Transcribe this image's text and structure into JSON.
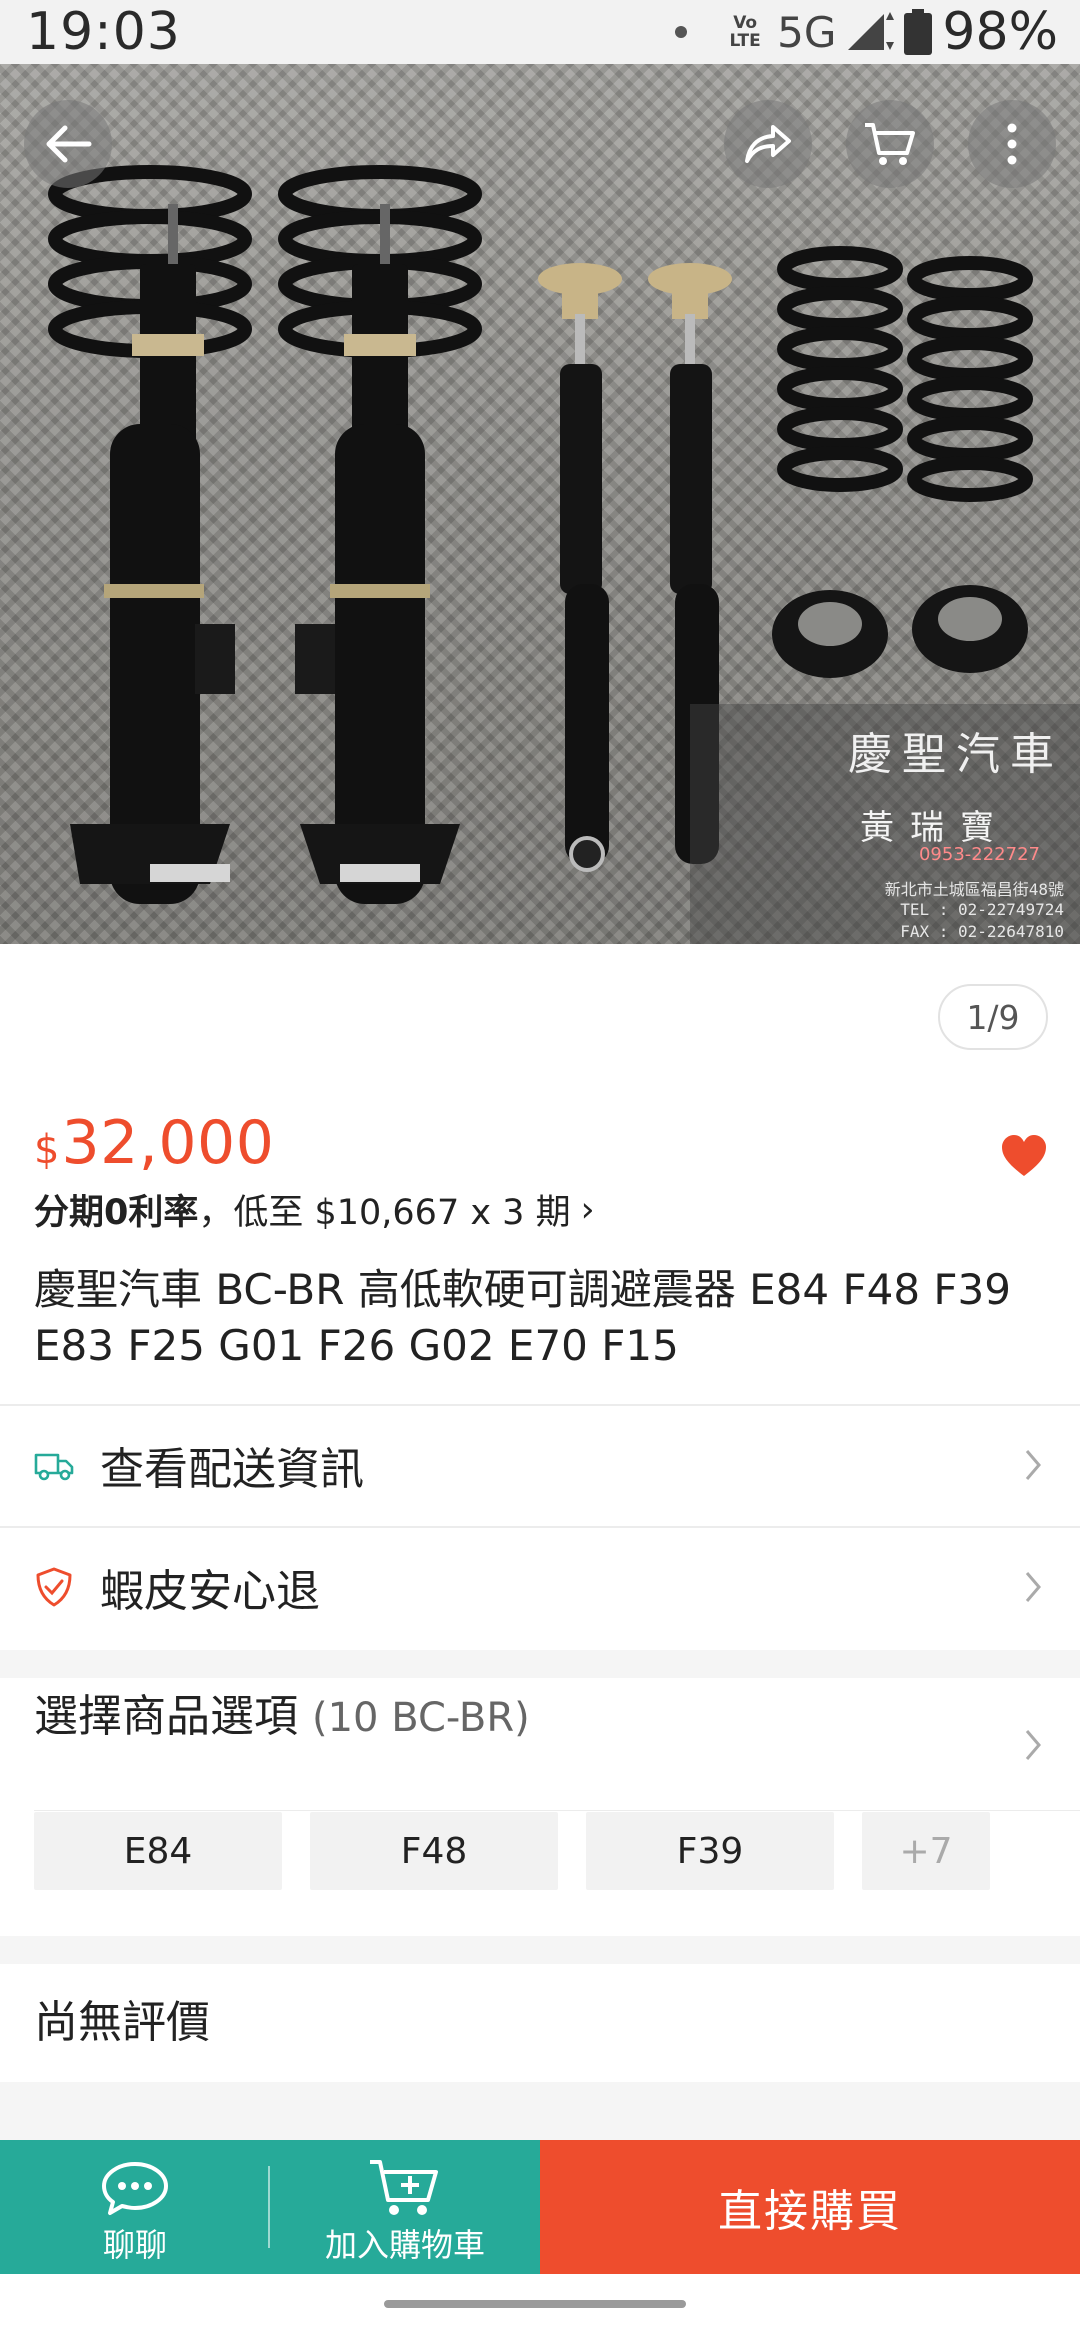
{
  "status_bar": {
    "time": "19:03",
    "network": "5G",
    "volte": "Vo LTE",
    "battery": "98%"
  },
  "hero": {
    "image": "shock-absorber-set-photo",
    "pager": "1/9",
    "watermark": {
      "title": "慶聖汽車",
      "name": "黃瑞寶",
      "phone": "0953-222727",
      "address": "新北市土城區福昌街48號",
      "tel": "TEL : 02-22749724",
      "fax": "FAX : 02-22647810"
    }
  },
  "product": {
    "currency": "$",
    "price": "32,000",
    "installment_bold": "分期0利率",
    "installment_rest": "，低至 $10,667 x 3 期",
    "installment_arrow": "›",
    "title": "慶聖汽車 BC-BR 高低軟硬可調避震器 E84 F48 F39 E83 F25 G01 F26 G02 E70 F15"
  },
  "rows": {
    "shipping": "查看配送資訊",
    "guarantee": "蝦皮安心退"
  },
  "variants": {
    "heading": "選擇商品選項",
    "count": "(10 BC-BR)",
    "chips": [
      "E84",
      "F48",
      "F39"
    ],
    "more": "+7"
  },
  "reviews": {
    "label": "尚無評價"
  },
  "bottom_bar": {
    "chat": "聊聊",
    "add_to_cart": "加入購物車",
    "buy_now": "直接購買"
  },
  "colors": {
    "accent": "#ee4d2d",
    "teal": "#26aa99"
  }
}
